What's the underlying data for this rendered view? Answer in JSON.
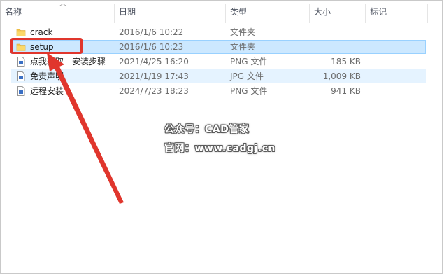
{
  "columns": {
    "name": "名称",
    "date": "日期",
    "type": "类型",
    "size": "大小",
    "tags": "标记"
  },
  "files": [
    {
      "name": "crack",
      "date": "2016/1/6 10:22",
      "type": "文件夹",
      "size": "",
      "icon": "folder-icon"
    },
    {
      "name": "setup",
      "date": "2016/1/6 10:23",
      "type": "文件夹",
      "size": "",
      "icon": "folder-icon"
    },
    {
      "name": "点我获取 - 安装步骤",
      "date": "2021/4/25 16:20",
      "type": "PNG 文件",
      "size": "185 KB",
      "icon": "image-file-icon"
    },
    {
      "name": "免责声明",
      "date": "2021/1/19 17:43",
      "type": "JPG 文件",
      "size": "1,009 KB",
      "icon": "image-file-icon"
    },
    {
      "name": "远程安装",
      "date": "2024/7/23 18:23",
      "type": "PNG 文件",
      "size": "941 KB",
      "icon": "image-file-icon"
    }
  ],
  "selected_index": 1,
  "hover_index": 3,
  "watermark": {
    "line1": "公众号：CAD管家",
    "line2": "官网：www.cadgj.cn"
  },
  "colors": {
    "selection_bg": "#cce8ff",
    "selection_border": "#99d1ff",
    "hover_bg": "#e5f3ff",
    "annotation": "#e0362d",
    "folder": "#f4c64f"
  }
}
